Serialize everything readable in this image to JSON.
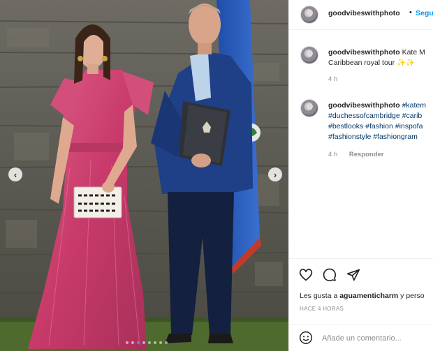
{
  "post": {
    "username": "goodvibeswithphoto",
    "follow_label": "Segu",
    "separator": "•"
  },
  "carousel": {
    "prev_icon": "chevron-left-icon",
    "next_icon": "chevron-right-icon",
    "dot_count": 8,
    "active_dot": 2
  },
  "comments": [
    {
      "username": "goodvibeswithphoto",
      "text_line1": "Kate M",
      "text_line2": "Caribbean royal tour ✨✨",
      "time": "4 h"
    },
    {
      "username": "goodvibeswithphoto",
      "lines": [
        "#katem",
        "#duchessofcambridge #carib",
        "#bestlooks #fashion #inspofa",
        "#fashionstyle #fashiongram"
      ],
      "time": "4 h",
      "reply_label": "Responder"
    }
  ],
  "actions": {
    "like_icon": "heart-icon",
    "comment_icon": "comment-bubble-icon",
    "share_icon": "paper-plane-icon"
  },
  "likes": {
    "prefix": "Les gusta a ",
    "user": "aguamenticharm",
    "suffix": " y perso"
  },
  "timestamp": "HACE 4 HORAS",
  "add_comment": {
    "emoji_icon": "smiley-icon",
    "placeholder": "Añade un comentario..."
  },
  "colors": {
    "link_blue": "#0095f6",
    "hashtag": "#00376b",
    "muted": "#8e8e8e"
  }
}
